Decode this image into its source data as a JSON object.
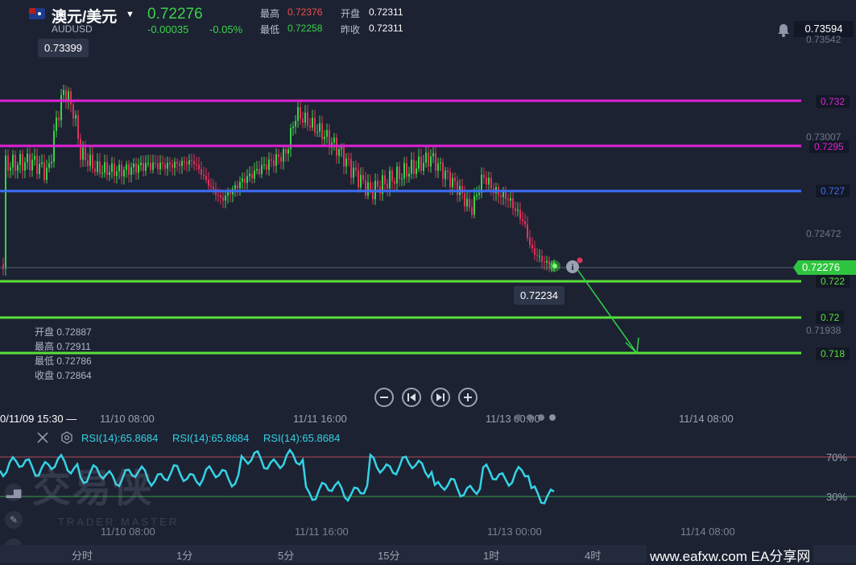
{
  "header": {
    "pair_name": "澳元/美元",
    "symbol": "AUDUSD",
    "price": "0.72276",
    "change": "-0.00035",
    "change_pct": "-0.05%",
    "stats": {
      "high_label": "最高",
      "high": "0.72376",
      "open_label": "开盘",
      "open": "0.72311",
      "low_label": "最低",
      "low": "0.72258",
      "prev_label": "昨收",
      "prev": "0.72311"
    },
    "top_price": "0.73594"
  },
  "price_axis": [
    "0.73542",
    "0.73007",
    "0.72472",
    "0.71938"
  ],
  "levels": [
    {
      "label": "0.732",
      "color": "#e021d4"
    },
    {
      "label": "0.7295",
      "color": "#e021d4"
    },
    {
      "label": "0.727",
      "color": "#3b6ff5"
    },
    {
      "label": "0.722",
      "color": "#5be03a"
    },
    {
      "label": "0.72",
      "color": "#5be03a"
    },
    {
      "label": "0.718",
      "color": "#5be03a"
    }
  ],
  "current_price_tag": "0.72276",
  "tooltips": {
    "high_point": "0.73399",
    "low_point": "0.72234"
  },
  "ohlc": {
    "open": "开盘 0.72887",
    "high": "最高 0.72911",
    "low": "最低 0.72786",
    "close": "收盘 0.72864"
  },
  "time_axis": {
    "cursor": "0/11/09 15:30 —",
    "labels": [
      "11/10 08:00",
      "11/11 16:00",
      "11/13 00:00",
      "11/14 08:00"
    ]
  },
  "rsi": {
    "labels": [
      "RSI(14):65.8684",
      "RSI(14):65.8684",
      "RSI(14):65.8684"
    ],
    "levels": [
      "70%",
      "30%"
    ]
  },
  "watermark": {
    "main": "交易侠",
    "sub": "TRADER MASTER"
  },
  "timeframes": [
    "分时",
    "1分",
    "5分",
    "15分",
    "1时",
    "4时"
  ],
  "site_credit": "www.eafxw.com  EA分享网",
  "colors": {
    "bg": "#1c2232",
    "up": "#3bd14a",
    "down": "#e0315a",
    "rsi": "#34d3e6"
  },
  "icons": {
    "close": "close-icon",
    "settings": "settings-icon",
    "bell": "bell-icon",
    "zoom_out": "minus-icon",
    "prev": "skip-back-icon",
    "next": "skip-forward-icon",
    "zoom_in": "plus-icon"
  }
}
